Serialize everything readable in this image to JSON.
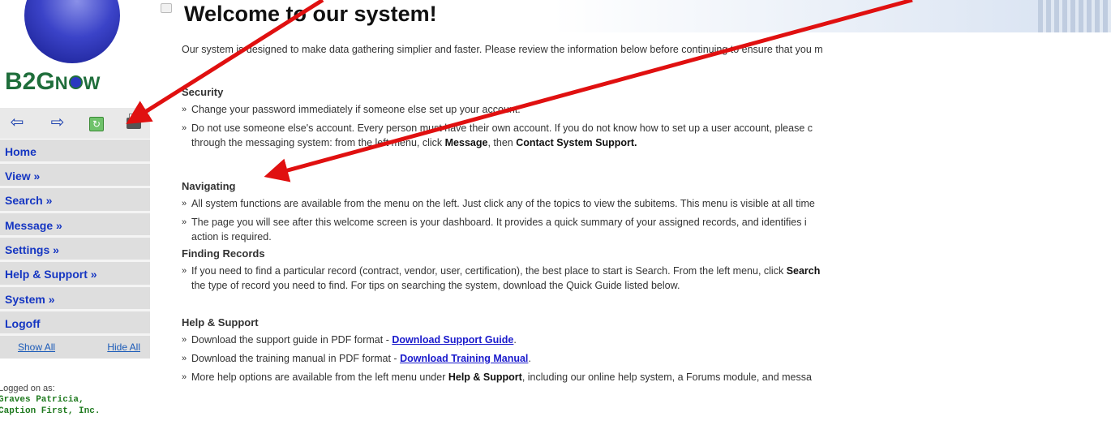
{
  "sidebar": {
    "logo": {
      "prefix": "B2G",
      "n": "N",
      "o": "O",
      "w": "W"
    },
    "toolbar": {
      "back": "⇦",
      "forward": "⇨",
      "refresh": "↻"
    },
    "menu": [
      {
        "label": "Home"
      },
      {
        "label": "View »"
      },
      {
        "label": "Search »"
      },
      {
        "label": "Message »"
      },
      {
        "label": "Settings »"
      },
      {
        "label": "Help & Support »"
      },
      {
        "label": "System »"
      },
      {
        "label": "Logoff"
      }
    ],
    "show_all": "Show All",
    "hide_all": "Hide All",
    "logged_label": "Logged on as:",
    "logged_name": "Graves Patricia,",
    "logged_company": "Caption First, Inc."
  },
  "main": {
    "title": "Welcome to our system!",
    "intro": "Our system is designed to make data gathering simplier and faster. Please review the information below before continuing to ensure that you m",
    "security": {
      "heading": "Security",
      "b1": "Change your password immediately if someone else set up your account.",
      "b2": "Do not use someone else's account. Every person must have their own account. If you do not know how to set up a user account, please c",
      "b2_cont_pre": "through the messaging system: from the left menu, click ",
      "b2_cont_message": "Message",
      "b2_cont_mid": ", then ",
      "b2_cont_contact": "Contact System Support."
    },
    "navigating": {
      "heading": "Navigating",
      "b1": "All system functions are available from the menu on the left. Just click any of the topics to view the subitems. This menu is visible at all time",
      "b2": "The page you will see after this welcome screen is your dashboard. It provides a quick summary of your assigned records, and identifies i",
      "b2_cont": "action is required."
    },
    "finding": {
      "heading": "Finding Records",
      "b1_pre": "If you need to find a particular record (contract, vendor, user, certification), the best place to start is Search. From the left menu, click ",
      "b1_bold": "Search",
      "b1_cont": "the type of record you need to find. For tips on searching the system, download the Quick Guide listed below."
    },
    "help": {
      "heading": "Help & Support",
      "b1_pre": "Download the support guide in PDF format - ",
      "b1_link": "Download Support Guide",
      "b1_post": ".",
      "b2_pre": "Download the training manual in PDF format - ",
      "b2_link": "Download Training Manual",
      "b2_post": ".",
      "b3_pre": "More help options are available from the left menu under ",
      "b3_bold": "Help & Support",
      "b3_post": ", including our online help system, a Forums module, and messa"
    }
  },
  "colors": {
    "menu_text": "#1536c2",
    "menu_bg": "#dedede",
    "logo_green": "#1f6e3b",
    "arrow": "#e01010"
  }
}
